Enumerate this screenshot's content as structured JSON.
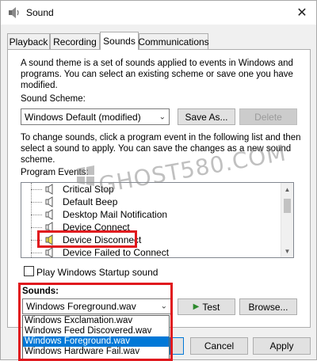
{
  "window": {
    "title": "Sound"
  },
  "tabs": [
    {
      "label": "Playback"
    },
    {
      "label": "Recording"
    },
    {
      "label": "Sounds"
    },
    {
      "label": "Communications"
    }
  ],
  "sounds_tab": {
    "description": "A sound theme is a set of sounds applied to events in Windows and programs.  You can select an existing scheme or save one you have modified.",
    "scheme_label": "Sound Scheme:",
    "scheme_value": "Windows Default (modified)",
    "save_as_label": "Save As...",
    "delete_label": "Delete",
    "instructions": "To change sounds, click a program event in the following list and then select a sound to apply.  You can save the changes as a new sound scheme.",
    "events_label": "Program Events:",
    "events": [
      {
        "label": "Critical Stop"
      },
      {
        "label": "Default Beep"
      },
      {
        "label": "Desktop Mail Notification"
      },
      {
        "label": "Device Connect"
      },
      {
        "label": "Device Disconnect"
      },
      {
        "label": "Device Failed to Connect"
      }
    ],
    "startup_sound_label": "Play Windows Startup sound",
    "sounds_label": "Sounds:",
    "sound_value": "Windows Foreground.wav",
    "test_label": "Test",
    "browse_label": "Browse...",
    "sound_options": [
      {
        "label": "Windows Exclamation.wav"
      },
      {
        "label": "Windows Feed Discovered.wav"
      },
      {
        "label": "Windows Foreground.wav"
      },
      {
        "label": "Windows Hardware Fail.wav"
      }
    ]
  },
  "footer": {
    "cancel_label": "Cancel",
    "apply_label": "Apply"
  },
  "watermark": "GHOST580.COM",
  "colors": {
    "highlight_red": "#e0191e",
    "selection_blue": "#0078d7"
  }
}
